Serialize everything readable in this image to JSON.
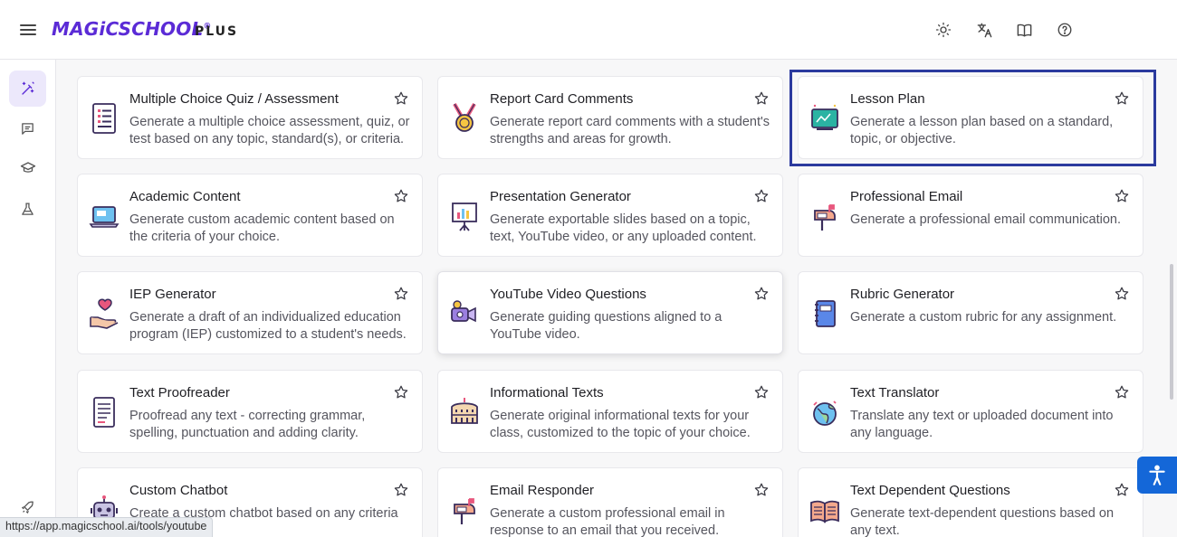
{
  "header": {
    "logo_text": "MAGiCSCHOOL",
    "plan_label": "PLUS",
    "icons": [
      "menu-icon",
      "sun-icon",
      "translate-icon",
      "book-icon",
      "help-icon"
    ]
  },
  "sidebar": {
    "icons": [
      "magic-wand-icon",
      "chat-icon",
      "graduation-cap-icon",
      "flask-icon",
      "rocket-icon"
    ]
  },
  "cards": [
    {
      "title": "Multiple Choice Quiz / Assessment",
      "desc": "Generate a multiple choice assessment, quiz, or test based on any topic, standard(s), or criteria.",
      "icon": "quiz-icon"
    },
    {
      "title": "Report Card Comments",
      "desc": "Generate report card comments with a student's strengths and areas for growth.",
      "icon": "medal-icon"
    },
    {
      "title": "Lesson Plan",
      "desc": "Generate a lesson plan based on a standard, topic, or objective.",
      "icon": "chalkboard-icon"
    },
    {
      "title": "Academic Content",
      "desc": "Generate custom academic content based on the criteria of your choice.",
      "icon": "laptop-icon"
    },
    {
      "title": "Presentation Generator",
      "desc": "Generate exportable slides based on a topic, text, YouTube video, or any uploaded content.",
      "icon": "presentation-icon"
    },
    {
      "title": "Professional Email",
      "desc": "Generate a professional email communication.",
      "icon": "mailbox-icon"
    },
    {
      "title": "IEP Generator",
      "desc": "Generate a draft of an individualized education program (IEP) customized to a student's needs.",
      "icon": "heart-hand-icon"
    },
    {
      "title": "YouTube Video Questions",
      "desc": "Generate guiding questions aligned to a YouTube video.",
      "icon": "video-camera-icon"
    },
    {
      "title": "Rubric Generator",
      "desc": "Generate a custom rubric for any assignment.",
      "icon": "notebook-icon"
    },
    {
      "title": "Text Proofreader",
      "desc": "Proofread any text - correcting grammar, spelling, punctuation and adding clarity.",
      "icon": "document-icon"
    },
    {
      "title": "Informational Texts",
      "desc": "Generate original informational texts for your class, customized to the topic of your choice.",
      "icon": "colosseum-icon"
    },
    {
      "title": "Text Translator",
      "desc": "Translate any text or uploaded document into any language.",
      "icon": "globe-icon"
    },
    {
      "title": "Custom Chatbot",
      "desc": "Create a custom chatbot based on any criteria",
      "icon": "robot-icon"
    },
    {
      "title": "Email Responder",
      "desc": "Generate a custom professional email in response to an email that you received.",
      "icon": "mailbox-icon"
    },
    {
      "title": "Text Dependent Questions",
      "desc": "Generate text-dependent questions based on any text.",
      "icon": "open-book-icon"
    }
  ],
  "status_url": "https://app.magicschool.ai/tools/youtube",
  "colors": {
    "brand": "#5b2bd6",
    "highlight": "#2b3a9e",
    "accessibility": "#1467d8"
  }
}
